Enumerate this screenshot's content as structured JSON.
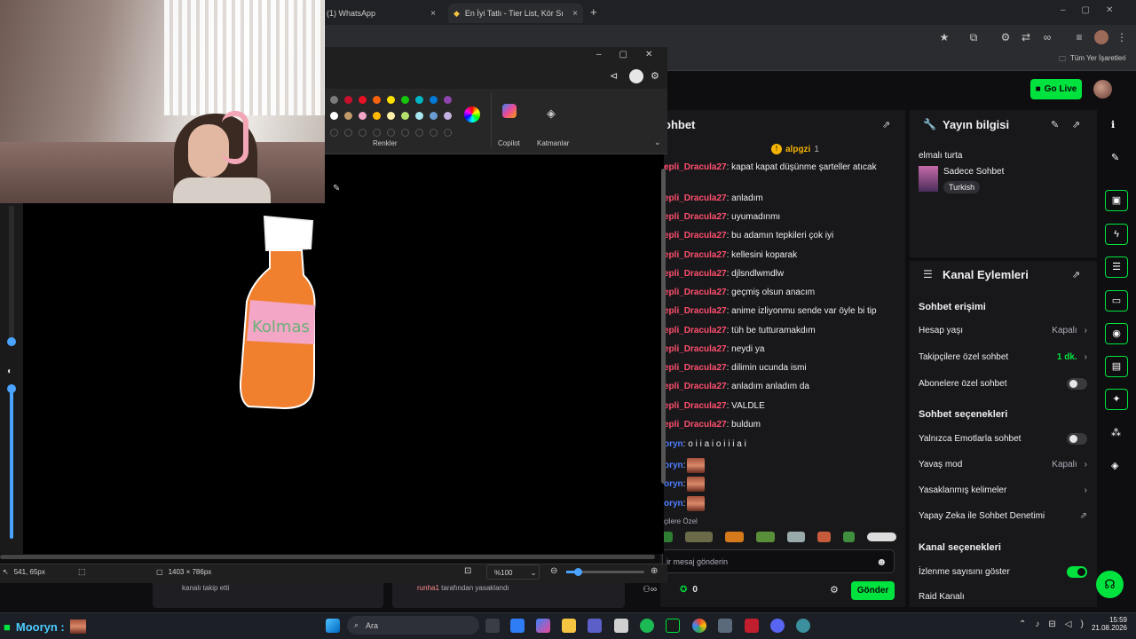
{
  "browser": {
    "tabs": [
      {
        "title": "(1) WhatsApp",
        "close": "×"
      },
      {
        "title": "En İyi Tatlı - Tier List, Kör Sıralam",
        "close": "×"
      }
    ],
    "new_tab": "+",
    "bookmarks_label": "Tüm Yer İşaretleri"
  },
  "twitch": {
    "go_live_label": "Go Live"
  },
  "chat": {
    "title": "ohbet",
    "pinned_user": "alpgzi",
    "pinned_count": "1",
    "messages": [
      {
        "user": "epli_Dracula27",
        "text": ": kapat kapat düşünme şarteller atıcak",
        "type": "red"
      },
      {
        "user": "epli_Dracula27",
        "text": ": anladım",
        "type": "red"
      },
      {
        "user": "epli_Dracula27",
        "text": ": uyumadınmı",
        "type": "red"
      },
      {
        "user": "epli_Dracula27",
        "text": ": bu adamın tepkileri çok iyi",
        "type": "red"
      },
      {
        "user": "epli_Dracula27",
        "text": ": kellesini koparak",
        "type": "red"
      },
      {
        "user": "epli_Dracula27",
        "text": ": djlsndlwmdlw",
        "type": "red"
      },
      {
        "user": "epli_Dracula27",
        "text": ": geçmiş olsun anacım",
        "type": "red"
      },
      {
        "user": "epli_Dracula27",
        "text": ": anime izliyonmu sende var öyle bi tip",
        "type": "red"
      },
      {
        "user": "epli_Dracula27",
        "text": ": tüh be tutturamakdım",
        "type": "red"
      },
      {
        "user": "epli_Dracula27",
        "text": ": neydi ya",
        "type": "red"
      },
      {
        "user": "epli_Dracula27",
        "text": ": dilimin ucunda ismi",
        "type": "red"
      },
      {
        "user": "epli_Dracula27",
        "text": ": anladım anladım da",
        "type": "red"
      },
      {
        "user": "epli_Dracula27",
        "text": ": VALDLE",
        "type": "red"
      },
      {
        "user": "epli_Dracula27",
        "text": ": buldum",
        "type": "red"
      },
      {
        "user": "oryn",
        "text": ": o i i a i o i i i a i",
        "type": "blue"
      },
      {
        "user": "oryn",
        "text": ":",
        "type": "blue-emote"
      },
      {
        "user": "oryn",
        "text": ":",
        "type": "blue-emote"
      },
      {
        "user": "oryn",
        "text": ":",
        "type": "blue-emote"
      }
    ],
    "emote_section_label": "çilere Özel",
    "input_placeholder": "ir mesaj gönderin",
    "points": "0",
    "send_label": "Gönder"
  },
  "stream_info": {
    "title": "Yayın bilgisi",
    "stream_title": "elmalı turta",
    "category": "Sadece Sohbet",
    "tag": "Turkish"
  },
  "channel_actions": {
    "title": "Kanal Eylemleri",
    "chat_access_heading": "Sohbet erişimi",
    "account_age_label": "Hesap yaşı",
    "account_age_value": "Kapalı",
    "followers_only_label": "Takipçilere özel sohbet",
    "followers_only_value": "1 dk.",
    "subscribers_only_label": "Abonelere özel sohbet",
    "chat_options_heading": "Sohbet seçenekleri",
    "emote_only_label": "Yalnızca Emotlarla sohbet",
    "slow_mode_label": "Yavaş mod",
    "slow_mode_value": "Kapalı",
    "banned_words_label": "Yasaklanmış kelimeler",
    "ai_moderation_label": "Yapay Zeka ile Sohbet Denetimi",
    "channel_options_heading": "Kanal seçenekleri",
    "show_viewcount_label": "İzlenme sayısını göster",
    "raid_label": "Raid Kanalı"
  },
  "paint": {
    "colors_label": "Renkler",
    "copilot_label": "Copilot",
    "layers_label": "Katmanlar",
    "cursor_pos": "541, 65px",
    "canvas_size": "1403 × 786px",
    "zoom": "%100",
    "palette": [
      "#7a7a7a",
      "#c8102e",
      "#e81123",
      "#f7630c",
      "#fce100",
      "#16c60c",
      "#00b7c3",
      "#0078d4",
      "#8e44ad",
      "#ffffff",
      "#c19a6b",
      "#f4a6c6",
      "#ffb900",
      "#fff1a8",
      "#b4e06b",
      "#a8e6f0",
      "#6b9bd1",
      "#c3b1e1"
    ],
    "bottle_text": "Kolmas"
  },
  "activity": {
    "followed_text": "kanalı takip etti",
    "banned_user": "runha1",
    "banned_text": " tarafından yasaklandı"
  },
  "taskbar": {
    "streamer": "Mooryn :",
    "search_label": "Ara",
    "time": "15:59",
    "date": "21.08.2026"
  }
}
